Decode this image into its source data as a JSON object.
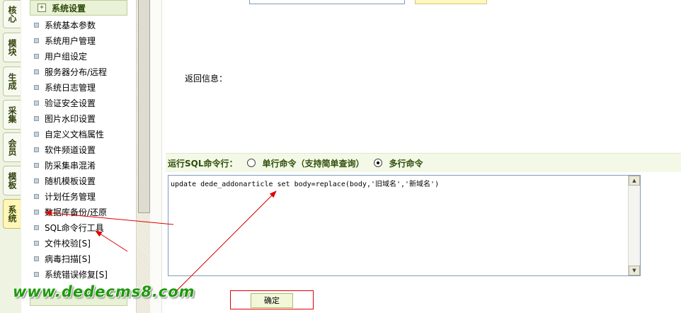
{
  "vertical_tabs": [
    {
      "label": "核心"
    },
    {
      "label": "模块"
    },
    {
      "label": "生成"
    },
    {
      "label": "采集"
    },
    {
      "label": "会员"
    },
    {
      "label": "模板"
    },
    {
      "label": "系统",
      "active": true
    }
  ],
  "menu": {
    "header": "系统设置",
    "items": [
      "系统基本参数",
      "系统用户管理",
      "用户组设定",
      "服务器分布/远程",
      "系统日志管理",
      "验证安全设置",
      "图片水印设置",
      "自定义文档属性",
      "软件频道设置",
      "防采集串混淆",
      "随机模板设置",
      "计划任务管理",
      "数据库备份/还原",
      "SQL命令行工具",
      "文件校验[S]",
      "病毒扫描[S]",
      "系统错误修复[S]"
    ]
  },
  "main": {
    "return_label": "返回信息：",
    "cmd_label": "运行SQL命令行：",
    "single_option": "单行命令（支持简单查询）",
    "multi_option": "多行命令",
    "selected_option": "多行命令",
    "sql_text": "update dede_addonarticle set body=replace(body,'旧域名','新域名')",
    "ok_button": "确定"
  },
  "watermark": "www.dedecms8.com",
  "colors": {
    "accent_green": "#2f4f0c",
    "annotation_red": "#e00000",
    "watermark_green": "#1f9a0c"
  }
}
